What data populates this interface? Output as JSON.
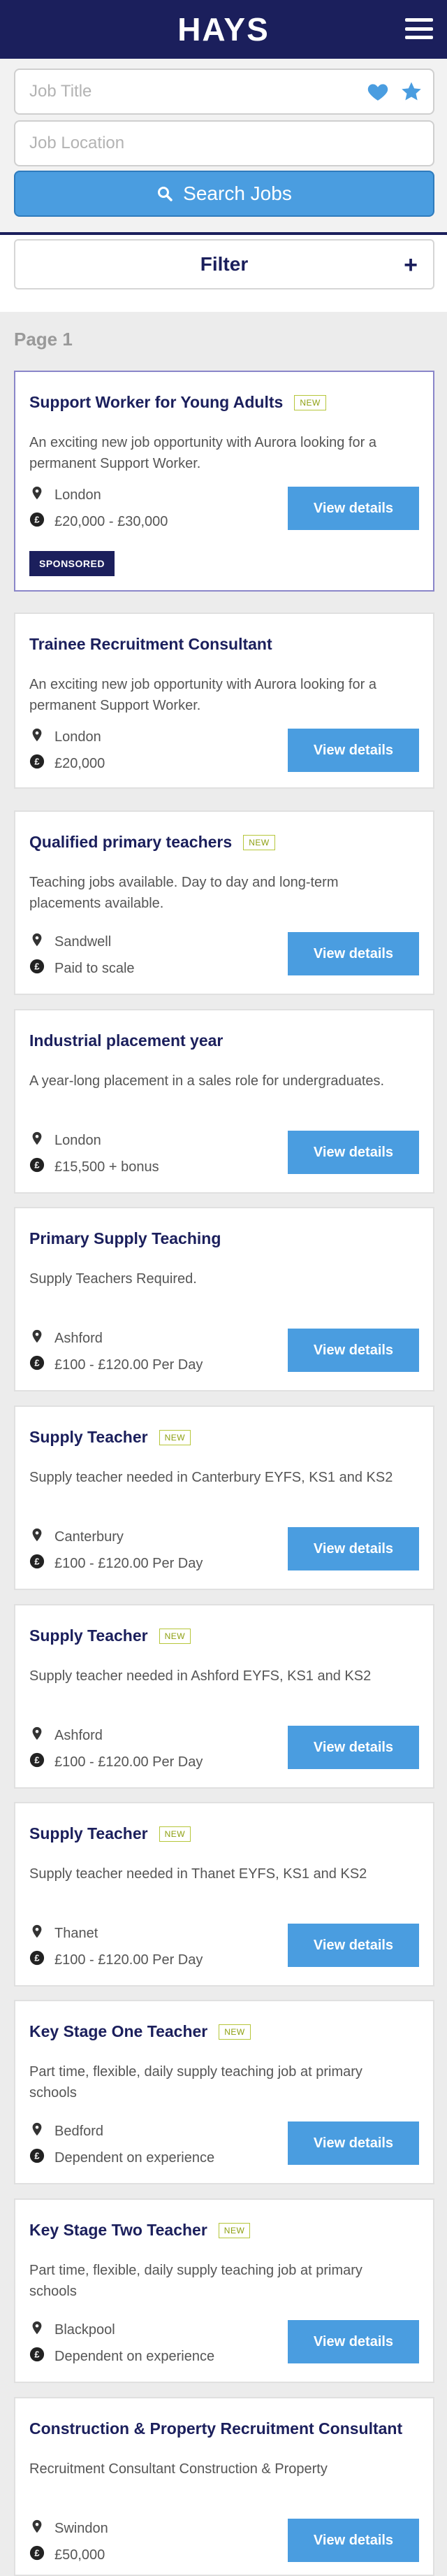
{
  "header": {
    "logo": "HAYS"
  },
  "search": {
    "job_title_placeholder": "Job Title",
    "job_location_placeholder": "Job Location",
    "search_button": "Search Jobs"
  },
  "filter": {
    "label": "Filter",
    "expand_symbol": "+"
  },
  "page_label": "Page 1",
  "colors": {
    "navy": "#1b1f5c",
    "accent_blue": "#4a9de0",
    "new_badge": "#8ea012"
  },
  "jobs": [
    {
      "title": "Support Worker for Young Adults",
      "new_badge": "NEW",
      "description": "An exciting new job opportunity with Aurora looking for a permanent Support Worker.",
      "location": "London",
      "salary": "£20,000 - £30,000",
      "button": "View details",
      "sponsored": "SPONSORED"
    },
    {
      "title": "Trainee Recruitment Consultant",
      "description": "An exciting new job opportunity with Aurora looking for a permanent Support Worker.",
      "location": "London",
      "salary": "£20,000",
      "button": "View details"
    },
    {
      "title": "Qualified primary teachers",
      "new_badge": "NEW",
      "description": "Teaching jobs available. Day to day and long-term placements available.",
      "location": "Sandwell",
      "salary": "Paid to scale",
      "button": "View details"
    },
    {
      "title": "Industrial placement year",
      "description": "A year-long placement in a sales role for undergraduates.",
      "location": "London",
      "salary": "£15,500 + bonus",
      "button": "View details"
    },
    {
      "title": "Primary Supply Teaching",
      "description": "Supply Teachers Required.",
      "location": "Ashford",
      "salary": "£100 - £120.00 Per Day",
      "button": "View details"
    },
    {
      "title": "Supply Teacher",
      "new_badge": "NEW",
      "description": "Supply teacher needed in Canterbury EYFS, KS1 and KS2",
      "location": "Canterbury",
      "salary": "£100 - £120.00 Per Day",
      "button": "View details"
    },
    {
      "title": "Supply Teacher",
      "new_badge": "NEW",
      "description": "Supply teacher needed in Ashford EYFS, KS1 and KS2",
      "location": "Ashford",
      "salary": "£100 - £120.00 Per Day",
      "button": "View details"
    },
    {
      "title": "Supply Teacher",
      "new_badge": "NEW",
      "description": "Supply teacher needed in Thanet EYFS, KS1 and KS2",
      "location": "Thanet",
      "salary": "£100 - £120.00 Per Day",
      "button": "View details"
    },
    {
      "title": "Key Stage One Teacher",
      "new_badge": "NEW",
      "description": "Part time, flexible, daily supply teaching job at primary schools",
      "location": "Bedford",
      "salary": "Dependent on experience",
      "button": "View details"
    },
    {
      "title": "Key Stage Two Teacher",
      "new_badge": "NEW",
      "description": "Part time, flexible, daily supply teaching job at primary schools",
      "location": "Blackpool",
      "salary": "Dependent on experience",
      "button": "View details"
    },
    {
      "title": "Construction & Property Recruitment Consultant",
      "description": "Recruitment Consultant Construction & Property",
      "location": "Swindon",
      "salary": "£50,000",
      "button": "View details"
    }
  ]
}
